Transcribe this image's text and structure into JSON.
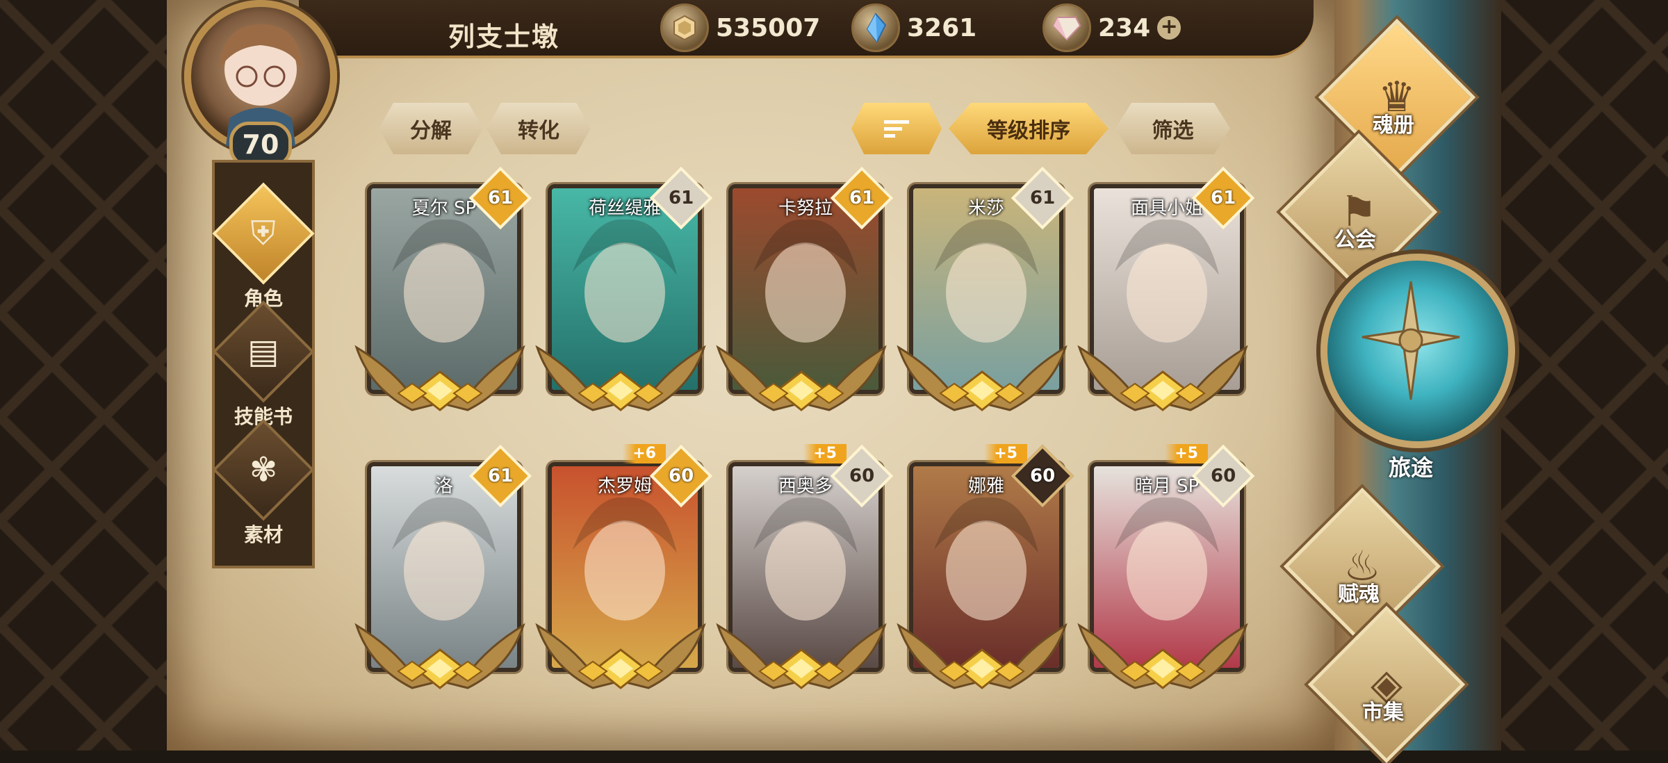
{
  "player": {
    "name": "列支士墩",
    "level": "70"
  },
  "currencies": [
    {
      "icon": "gold-coin-icon",
      "value": "535007"
    },
    {
      "icon": "blue-crystal-icon",
      "value": "3261"
    },
    {
      "icon": "pink-gem-icon",
      "value": "234"
    }
  ],
  "left_menu": [
    {
      "label": "角色",
      "icon": "helmet-icon",
      "active": true
    },
    {
      "label": "技能书",
      "icon": "skill-book-icon",
      "active": false
    },
    {
      "label": "素材",
      "icon": "material-icon",
      "active": false
    }
  ],
  "actions": {
    "decompose": "分解",
    "convert": "转化",
    "sort_icon": "sort-icon",
    "sort_level": "等级排序",
    "filter": "筛选"
  },
  "cards": [
    {
      "name": "夏尔 SP",
      "level": "61",
      "badge": "gold",
      "plus": "",
      "palette": [
        "#9aa6a2",
        "#5d6c6a"
      ]
    },
    {
      "name": "荷丝缇雅",
      "level": "61",
      "badge": "silver",
      "plus": "",
      "palette": [
        "#48b8a6",
        "#24706a"
      ]
    },
    {
      "name": "卡努拉",
      "level": "61",
      "badge": "gold",
      "plus": "",
      "palette": [
        "#9c4a2e",
        "#4a5a3a"
      ]
    },
    {
      "name": "米莎",
      "level": "61",
      "badge": "silver",
      "plus": "",
      "palette": [
        "#c9b47a",
        "#7aa0a0"
      ]
    },
    {
      "name": "面具小姐",
      "level": "61",
      "badge": "gold",
      "plus": "",
      "palette": [
        "#eae2da",
        "#a89e96"
      ]
    },
    {
      "name": "洛",
      "level": "61",
      "badge": "gold",
      "plus": "",
      "palette": [
        "#d8dcdc",
        "#7a8486"
      ]
    },
    {
      "name": "杰罗姆",
      "level": "60",
      "badge": "gold",
      "plus": "+6",
      "palette": [
        "#c8522e",
        "#d6a84a"
      ]
    },
    {
      "name": "西奥多",
      "level": "60",
      "badge": "silver",
      "plus": "+5",
      "palette": [
        "#d5d0cc",
        "#5a4a46"
      ]
    },
    {
      "name": "娜雅",
      "level": "60",
      "badge": "dark",
      "plus": "+5",
      "palette": [
        "#b07a48",
        "#6a2e2a"
      ]
    },
    {
      "name": "暗月 SP",
      "level": "60",
      "badge": "silver",
      "plus": "+5",
      "palette": [
        "#e6e2dc",
        "#b23a4a"
      ]
    }
  ],
  "right_menu": [
    {
      "label": "魂册",
      "icon": "soul-book-icon",
      "active": true
    },
    {
      "label": "公会",
      "icon": "guild-icon",
      "active": false
    },
    {
      "label": "旅途",
      "icon": "journey-compass-icon",
      "active": false
    },
    {
      "label": "赋魂",
      "icon": "soul-flame-icon",
      "active": false
    },
    {
      "label": "市集",
      "icon": "market-gem-icon",
      "active": false
    }
  ]
}
